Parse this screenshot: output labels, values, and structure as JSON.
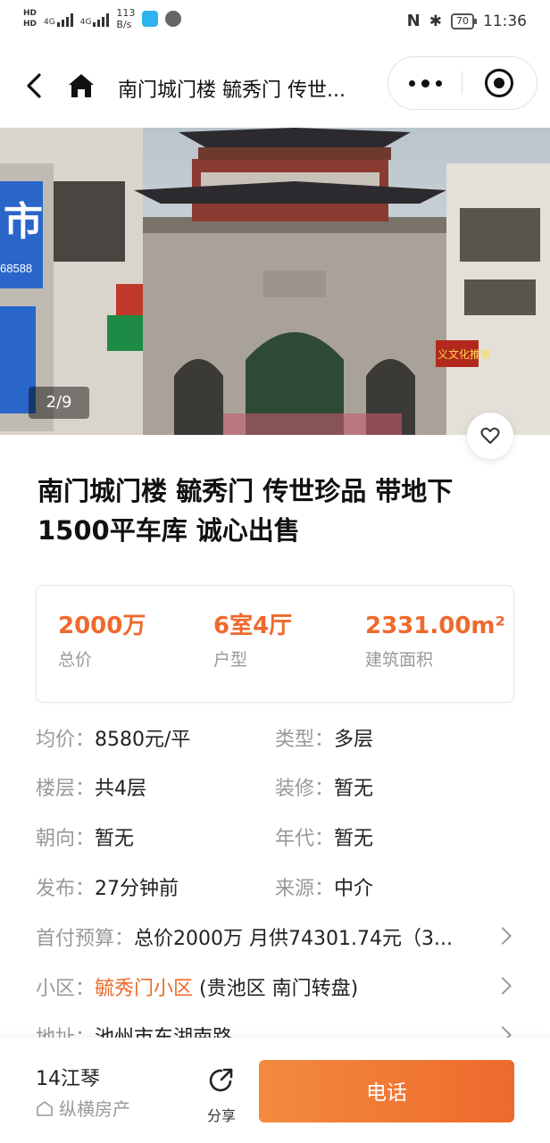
{
  "status_bar": {
    "network_speed": "113",
    "network_speed_unit": "B/s",
    "signal_labels": [
      "4G",
      "4G"
    ],
    "hd_labels": [
      "HD",
      "HD"
    ],
    "battery": "70",
    "time": "11:36"
  },
  "nav": {
    "title": "南门城门楼 毓秀门 传世...",
    "icons": {
      "back": "back-chevron-icon",
      "home": "home-icon",
      "more": "more-dots-icon",
      "close": "miniprogram-close-icon"
    }
  },
  "gallery": {
    "counter": "2/9",
    "signs": [
      "市",
      "68588",
      "义文化推拿"
    ]
  },
  "listing": {
    "title": "南门城门楼 毓秀门 传世珍品 带地下1500平车库 诚心出售"
  },
  "summary": [
    {
      "value": "2000万",
      "label": "总价"
    },
    {
      "value": "6室4厅",
      "label": "户型"
    },
    {
      "value": "2331.00m²",
      "label": "建筑面积"
    }
  ],
  "attributes": [
    {
      "key": "均价：",
      "value": "8580元/平"
    },
    {
      "key": "类型：",
      "value": "多层"
    },
    {
      "key": "楼层：",
      "value": "共4层"
    },
    {
      "key": "装修：",
      "value": "暂无"
    },
    {
      "key": "朝向：",
      "value": "暂无"
    },
    {
      "key": "年代：",
      "value": "暂无"
    },
    {
      "key": "发布：",
      "value": "27分钟前"
    },
    {
      "key": "来源：",
      "value": "中介"
    }
  ],
  "budget": {
    "key": "首付预算：",
    "value": "总价2000万 月供74301.74元（3..."
  },
  "community": {
    "key": "小区：",
    "name": "毓秀门小区",
    "area": " (贵池区 南门转盘)"
  },
  "address": {
    "key": "地址：",
    "value": "池州市东湖南路"
  },
  "bottom_bar": {
    "agent_name": "14江琴",
    "agency": "纵横房产",
    "share_label": "分享",
    "call_label": "电话"
  },
  "colors": {
    "accent": "#ee6a2c",
    "muted": "#999999",
    "text": "#222222"
  }
}
